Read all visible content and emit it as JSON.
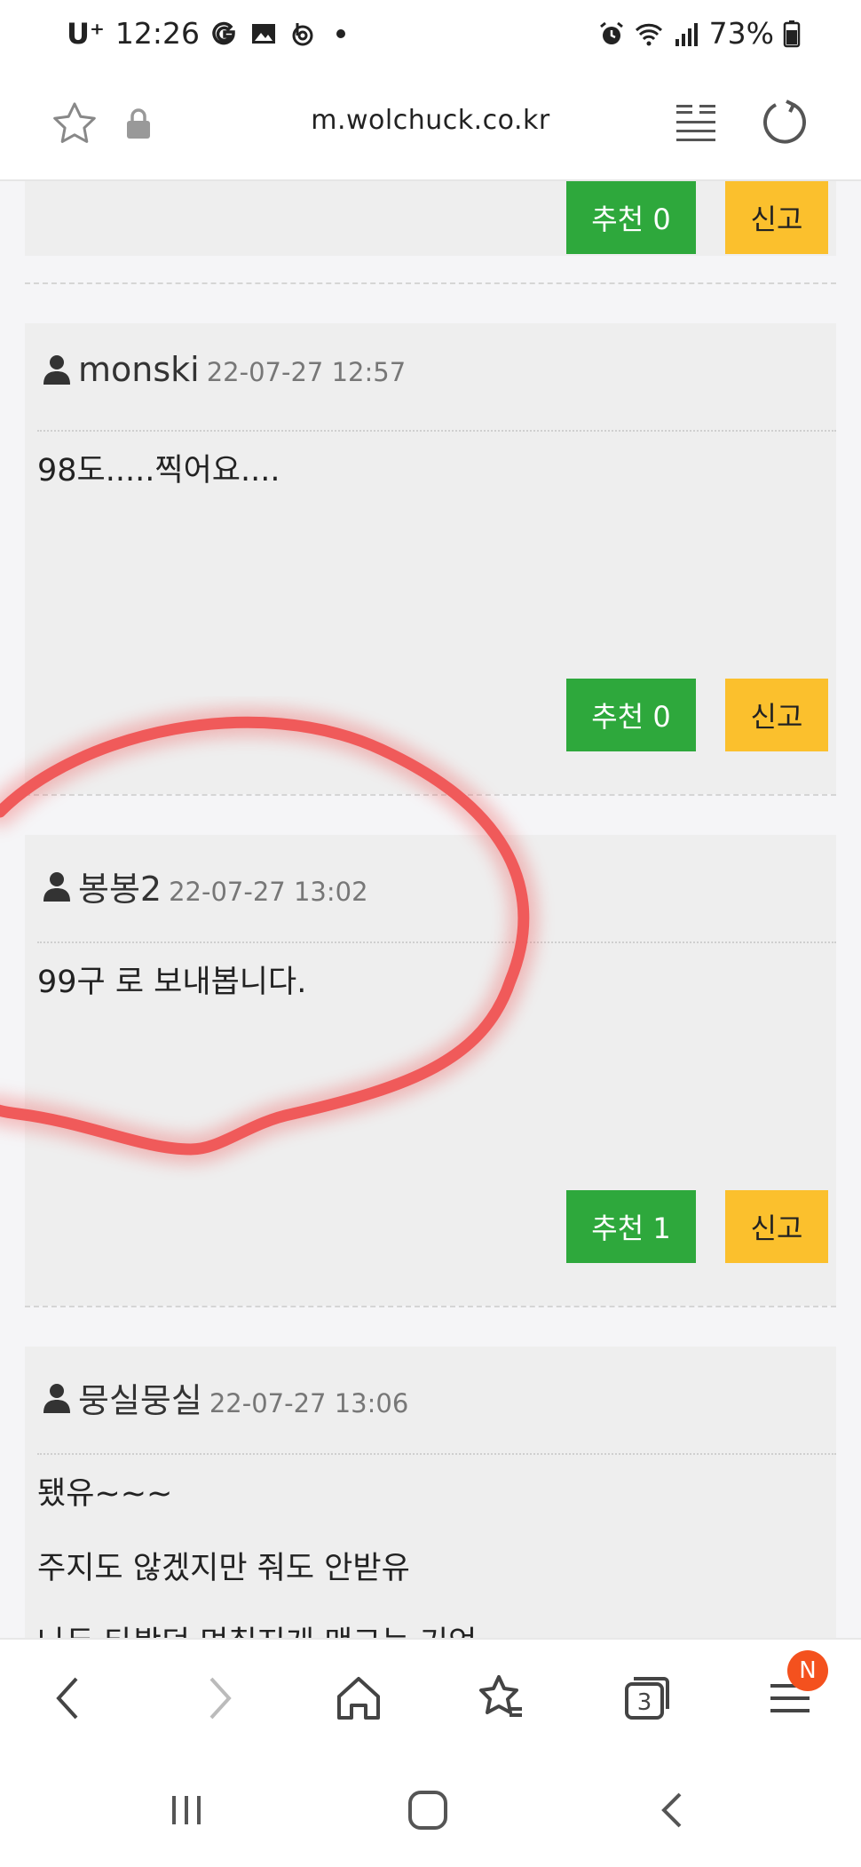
{
  "status_bar": {
    "carrier": "U⁺",
    "time": "12:26",
    "battery": "73%"
  },
  "browser": {
    "url": "m.wolchuck.co.kr",
    "tab_count": "3",
    "menu_badge": "N"
  },
  "comments": [
    {
      "author": "",
      "date": "",
      "lines": [],
      "recommend_label": "추천 0",
      "report_label": "신고"
    },
    {
      "author": "monski",
      "date": "22-07-27 12:57",
      "lines": [
        "98도.....찍어요...."
      ],
      "recommend_label": "추천 0",
      "report_label": "신고"
    },
    {
      "author": "봉봉2",
      "date": "22-07-27 13:02",
      "lines": [
        "99구 로 보내봅니다."
      ],
      "recommend_label": "추천 1",
      "report_label": "신고"
    },
    {
      "author": "뭉실뭉실",
      "date": "22-07-27 13:06",
      "lines": [
        "됐유~~~",
        "주지도 않겠지만 줘도 안받유",
        "나두 타봤던 며칠지게 맨그는 기억"
      ]
    }
  ],
  "colors": {
    "recommend_button": "#2ea83c",
    "report_button": "#fbc02d",
    "highlight": "#f05a5a",
    "badge": "#f4511e"
  },
  "icons": [
    "star-icon",
    "lock-icon",
    "reader-icon",
    "reload-icon",
    "user-icon",
    "back-icon",
    "forward-icon",
    "home-icon",
    "bookmarks-icon",
    "tabs-icon",
    "menu-icon"
  ]
}
